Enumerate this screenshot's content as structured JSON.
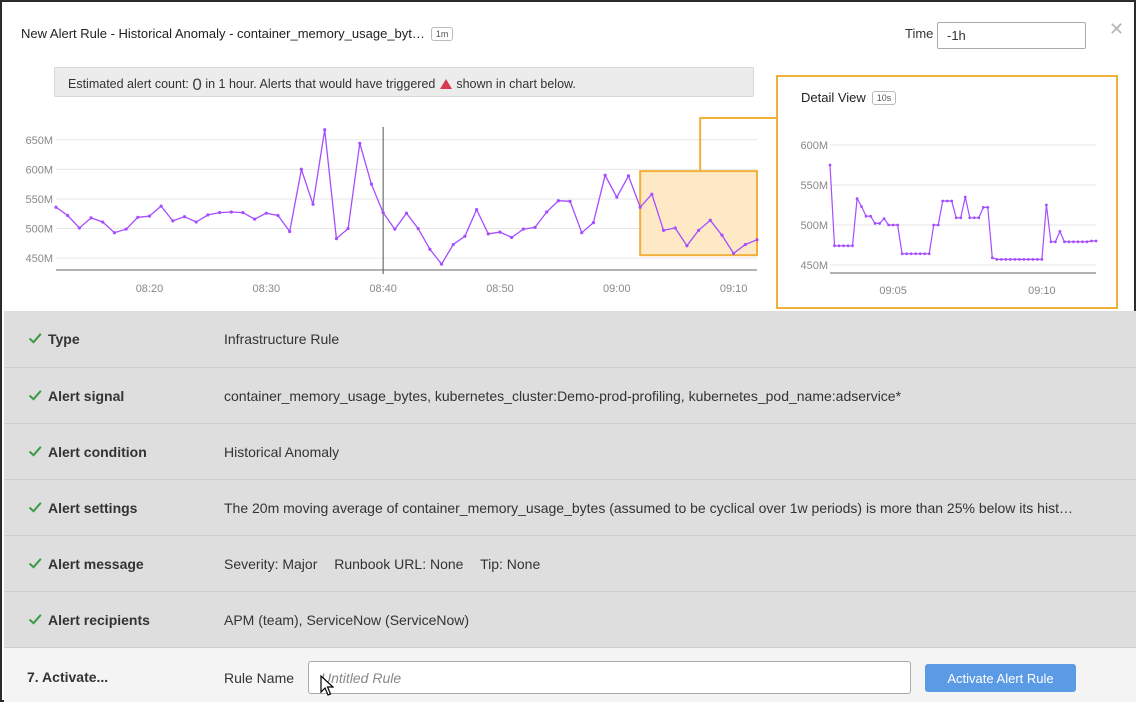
{
  "header": {
    "title": "New Alert Rule - Historical Anomaly - container_memory_usage_byt…",
    "resolution_badge": "1m",
    "time_label": "Time",
    "time_value": "-1h",
    "close_icon": "close-icon"
  },
  "estimate": {
    "prefix": "Estimated alert count:",
    "count": "0",
    "middle": "in 1 hour. Alerts that would have triggered",
    "suffix": "shown in chart below.",
    "marker_color": "#d83a56"
  },
  "chart_data": [
    {
      "type": "line",
      "y_ticks": [
        "650M",
        "600M",
        "550M",
        "500M",
        "450M"
      ],
      "x_ticks": [
        "08:20",
        "08:30",
        "08:40",
        "08:50",
        "09:00",
        "09:10"
      ],
      "ylim": [
        430,
        680
      ],
      "grid": true,
      "line_color": "#a64dff",
      "highlight_color": "#f0b03a",
      "series": [
        {
          "x": [
            "08:12",
            "08:13",
            "08:14",
            "08:15",
            "08:16",
            "08:17",
            "08:18",
            "08:19",
            "08:20",
            "08:21",
            "08:22",
            "08:23",
            "08:24",
            "08:25",
            "08:26",
            "08:27",
            "08:28",
            "08:29",
            "08:30",
            "08:31",
            "08:32",
            "08:33",
            "08:34",
            "08:35",
            "08:36",
            "08:37",
            "08:38",
            "08:39",
            "08:40",
            "08:41",
            "08:42",
            "08:43",
            "08:44",
            "08:45",
            "08:46",
            "08:47",
            "08:48",
            "08:49",
            "08:50",
            "08:51",
            "08:52",
            "08:53",
            "08:54",
            "08:55",
            "08:56",
            "08:57",
            "08:58",
            "08:59",
            "09:00",
            "09:01",
            "09:02",
            "09:03",
            "09:04",
            "09:05",
            "09:06",
            "09:07",
            "09:08",
            "09:09",
            "09:10",
            "09:11",
            "09:12"
          ],
          "values": [
            536,
            522,
            501,
            518,
            511,
            493,
            499,
            519,
            521,
            538,
            513,
            520,
            511,
            523,
            527,
            528,
            527,
            516,
            526,
            522,
            495,
            600,
            541,
            667,
            483,
            500,
            644,
            575,
            527,
            499,
            526,
            500,
            465,
            440,
            473,
            487,
            532,
            491,
            494,
            485,
            499,
            502,
            528,
            547,
            546,
            493,
            510,
            590,
            553,
            589,
            536,
            558,
            497,
            501,
            471,
            497,
            514,
            489,
            458,
            473,
            481
          ]
        }
      ]
    },
    {
      "type": "line",
      "title": "Detail View",
      "resolution_badge": "10s",
      "y_ticks": [
        "600M",
        "550M",
        "500M",
        "450M"
      ],
      "x_ticks": [
        "09:05",
        "09:10"
      ],
      "ylim": [
        440,
        610
      ],
      "grid": true,
      "line_color": "#a64dff",
      "series": [
        {
          "values": [
            575,
            474,
            474,
            474,
            474,
            474,
            533,
            523,
            511,
            511,
            502,
            502,
            508,
            500,
            500,
            500,
            464,
            464,
            464,
            464,
            464,
            464,
            464,
            500,
            500,
            530,
            530,
            530,
            509,
            509,
            535,
            509,
            509,
            509,
            522,
            522,
            459,
            457,
            457,
            457,
            457,
            457,
            457,
            457,
            457,
            457,
            457,
            457,
            525,
            479,
            479,
            492,
            479,
            479,
            479,
            479,
            479,
            479,
            480,
            480
          ]
        }
      ]
    }
  ],
  "steps": [
    {
      "label": "Type",
      "value": "Infrastructure Rule"
    },
    {
      "label": "Alert signal",
      "value": "container_memory_usage_bytes, kubernetes_cluster:Demo-prod-profiling, kubernetes_pod_name:adservice*"
    },
    {
      "label": "Alert condition",
      "value": "Historical Anomaly"
    },
    {
      "label": "Alert settings",
      "value": "The 20m moving average of container_memory_usage_bytes (assumed to be cyclical over 1w periods) is more than 25% below its hist…"
    },
    {
      "label": "Alert message",
      "severity": "Severity: Major",
      "runbook": "Runbook URL: None",
      "tip": "Tip: None"
    },
    {
      "label": "Alert recipients",
      "value": "APM (team), ServiceNow (ServiceNow)"
    }
  ],
  "activate": {
    "step_label": "7.  Activate...",
    "rule_name_label": "Rule Name",
    "rule_name_placeholder": "Untitled Rule",
    "button_label": "Activate Alert Rule",
    "accent_color": "#5b9ae4"
  }
}
